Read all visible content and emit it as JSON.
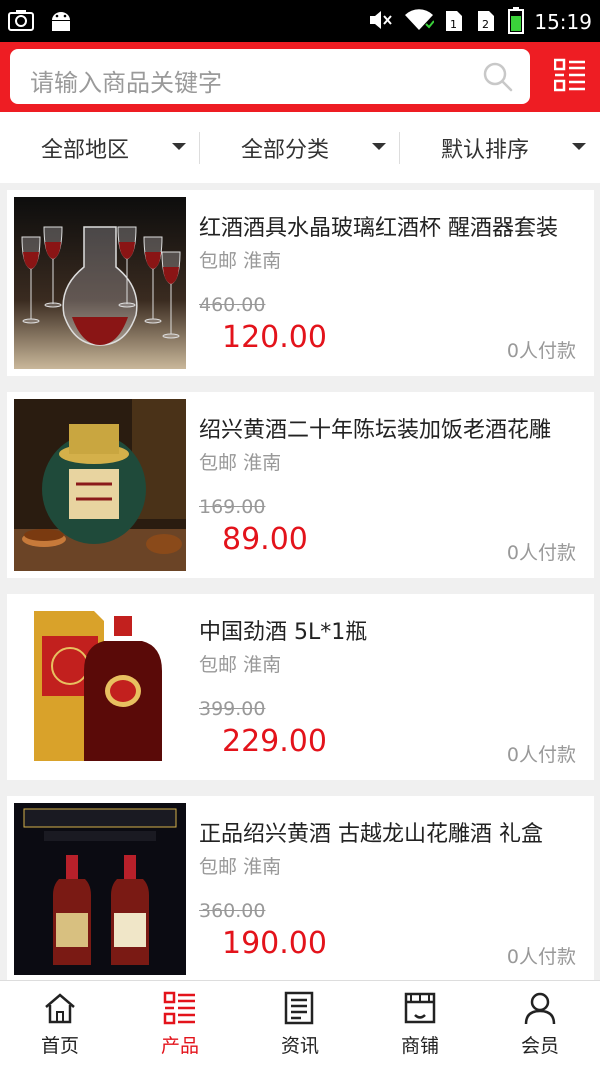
{
  "status_bar": {
    "time": "15:19",
    "left_icons": [
      "screenshot-icon",
      "android-icon"
    ],
    "right_icons": [
      "mute-icon",
      "wifi-icon",
      "sim1-icon",
      "sim2-icon",
      "battery-icon"
    ]
  },
  "header": {
    "search_placeholder": "请输入商品关键字",
    "accent_color": "#ee1d23",
    "search_icon": "search-icon",
    "menu_icon": "category-list-icon"
  },
  "filters": [
    {
      "label": "全部地区"
    },
    {
      "label": "全部分类"
    },
    {
      "label": "默认排序"
    }
  ],
  "products": [
    {
      "title": "红酒酒具水晶玻璃红酒杯 醒酒器套装",
      "shipping": "包邮",
      "location": "淮南",
      "old_price": "460.00",
      "price": "120.00",
      "sold": "0人付款"
    },
    {
      "title": "绍兴黄酒二十年陈坛装加饭老酒花雕",
      "shipping": "包邮",
      "location": "淮南",
      "old_price": "169.00",
      "price": "89.00",
      "sold": "0人付款"
    },
    {
      "title": "中国劲酒 5L*1瓶",
      "shipping": "包邮",
      "location": "淮南",
      "old_price": "399.00",
      "price": "229.00",
      "sold": "0人付款"
    },
    {
      "title": "正品绍兴黄酒 古越龙山花雕酒 礼盒",
      "shipping": "包邮",
      "location": "淮南",
      "old_price": "360.00",
      "price": "190.00",
      "sold": "0人付款"
    }
  ],
  "bottom_nav": [
    {
      "label": "首页",
      "icon": "home-icon",
      "active": false
    },
    {
      "label": "产品",
      "icon": "product-list-icon",
      "active": true
    },
    {
      "label": "资讯",
      "icon": "news-icon",
      "active": false
    },
    {
      "label": "商铺",
      "icon": "shop-icon",
      "active": false
    },
    {
      "label": "会员",
      "icon": "member-icon",
      "active": false
    }
  ]
}
